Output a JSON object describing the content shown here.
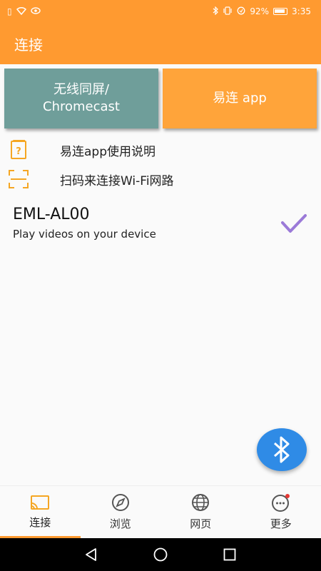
{
  "status_bar": {
    "battery_percent": "92%",
    "time": "3:35"
  },
  "app_bar": {
    "title": "连接"
  },
  "mode_buttons": {
    "wireless_line1": "无线同屏/",
    "wireless_line2": "Chromecast",
    "easy_app": "易连 app"
  },
  "links": [
    {
      "label": "易连app使用说明",
      "icon": "help-document-icon"
    },
    {
      "label": "扫码来连接Wi-Fi网路",
      "icon": "scan-qr-icon"
    }
  ],
  "device": {
    "name": "EML-AL00",
    "subtitle": "Play videos on your device"
  },
  "bottom_nav": {
    "items": [
      {
        "label": "连接",
        "icon": "cast-icon"
      },
      {
        "label": "浏览",
        "icon": "compass-icon"
      },
      {
        "label": "网页",
        "icon": "globe-icon"
      },
      {
        "label": "更多",
        "icon": "more-chat-icon"
      }
    ]
  },
  "colors": {
    "primary": "#ff9a30",
    "wireless_btn": "#6f9e9a",
    "check": "#9b7ad8",
    "fab": "#2f8be6"
  }
}
